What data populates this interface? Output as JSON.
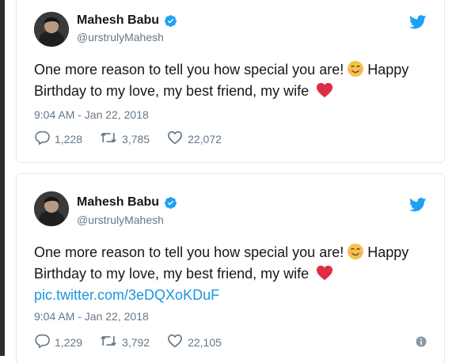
{
  "colors": {
    "accent": "#1da1f2",
    "link": "#1b95e0",
    "muted": "#657786",
    "heart": "#e0245e",
    "text": "#14171a"
  },
  "tweets": [
    {
      "author": {
        "name": "Mahesh Babu",
        "handle": "@urstrulyMahesh",
        "verified": true
      },
      "text_line1": "One more reason to tell you how special you are!",
      "text_line1_after": "Happy",
      "text_line2": "Birthday to my love, my best friend, my wife",
      "link": "",
      "timestamp": "9:04 AM - Jan 22, 2018",
      "replies": "1,228",
      "retweets": "3,785",
      "likes": "22,072",
      "icons": [
        "reply-icon",
        "retweet-icon",
        "like-icon",
        "twitter-bird-icon",
        "verified-icon",
        "smiling-emoji-icon",
        "heart-emoji-icon"
      ]
    },
    {
      "author": {
        "name": "Mahesh Babu",
        "handle": "@urstrulyMahesh",
        "verified": true
      },
      "text_line1": "One more reason to tell you how special you are!",
      "text_line1_after": "Happy",
      "text_line2": "Birthday to my love, my best friend, my wife",
      "link": "pic.twitter.com/3eDQXoKDuF",
      "timestamp": "9:04 AM - Jan 22, 2018",
      "replies": "1,229",
      "retweets": "3,792",
      "likes": "22,105",
      "icons": [
        "reply-icon",
        "retweet-icon",
        "like-icon",
        "twitter-bird-icon",
        "verified-icon",
        "smiling-emoji-icon",
        "heart-emoji-icon",
        "info-icon"
      ]
    }
  ]
}
